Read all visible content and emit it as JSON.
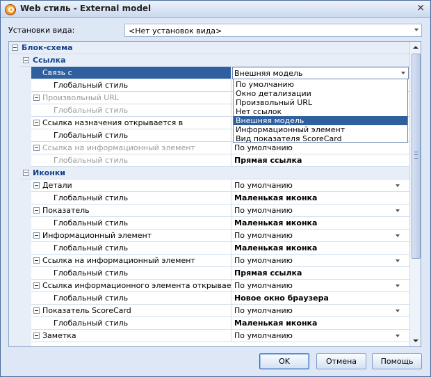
{
  "window": {
    "title": "Web стиль - External model"
  },
  "view_settings": {
    "label": "Установки вида:",
    "value": "<Нет установок вида>"
  },
  "grid": {
    "category": "Блок-схема",
    "groups": [
      {
        "label": "Ссылка"
      },
      {
        "label": "Иконки"
      }
    ],
    "rows": [
      {
        "name": "Связь с",
        "value": "Внешняя модель"
      },
      {
        "name": "Глобальный стиль",
        "value": ""
      },
      {
        "name": "Произвольный URL",
        "value": ""
      },
      {
        "name": "Глобальный стиль",
        "value": ""
      },
      {
        "name": "Ссылка назначения открывается в",
        "value": ""
      },
      {
        "name": "Глобальный стиль",
        "value": ""
      },
      {
        "name": "Ссылка на информационный элемент",
        "value": "По умолчанию"
      },
      {
        "name": "Глобальный стиль",
        "value": "Прямая ссылка"
      },
      {
        "name": "Детали",
        "value": "По умолчанию"
      },
      {
        "name": "Глобальный стиль",
        "value": "Маленькая иконка"
      },
      {
        "name": "Показатель",
        "value": "По умолчанию"
      },
      {
        "name": "Глобальный стиль",
        "value": "Маленькая иконка"
      },
      {
        "name": "Информационный элемент",
        "value": "По умолчанию"
      },
      {
        "name": "Глобальный стиль",
        "value": "Маленькая иконка"
      },
      {
        "name": "Ссылка на информационный элемент",
        "value": "По умолчанию"
      },
      {
        "name": "Глобальный стиль",
        "value": "Прямая ссылка"
      },
      {
        "name": "Ссылка информационного элемента открывается в",
        "value": "По умолчанию"
      },
      {
        "name": "Глобальный стиль",
        "value": "Новое окно браузера"
      },
      {
        "name": "Показатель ScoreCard",
        "value": "По умолчанию"
      },
      {
        "name": "Глобальный стиль",
        "value": "Маленькая иконка"
      },
      {
        "name": "Заметка",
        "value": "По умолчанию"
      }
    ]
  },
  "dropdown": {
    "options": [
      "По умолчанию",
      "Окно детализации",
      "Произвольный URL",
      "Нет ссылок",
      "Внешняя модель",
      "Информационный элемент",
      "Вид показателя ScoreCard"
    ],
    "selected": "Внешняя модель"
  },
  "buttons": {
    "ok": "OK",
    "cancel": "Отмена",
    "help": "Помощь"
  }
}
